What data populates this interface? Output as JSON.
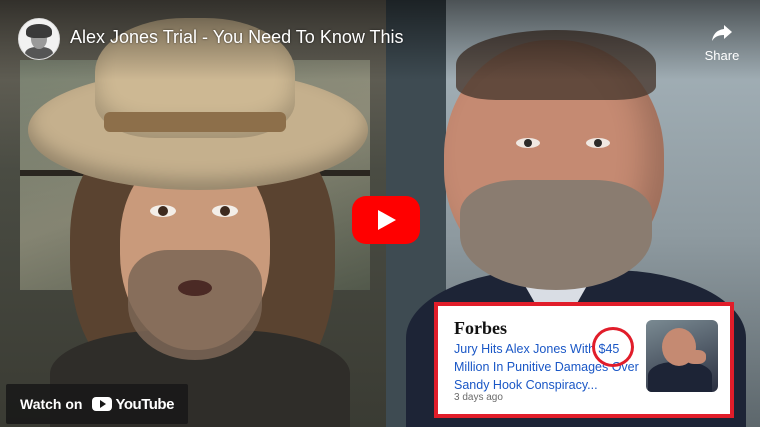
{
  "video": {
    "title": "Alex Jones Trial - You Need To Know This",
    "share_label": "Share",
    "watch_on_label": "Watch on",
    "platform_name": "YouTube"
  },
  "forbes_card": {
    "brand": "Forbes",
    "headline_before": "Jury Hits Alex Jones With ",
    "headline_amount": "$45",
    "headline_after": " Million In Punitive Damages Over Sandy Hook Conspiracy...",
    "time_ago": "3 days ago"
  },
  "icons": {
    "share": "share-arrow-icon",
    "play": "play-icon",
    "youtube": "youtube-logo-icon"
  },
  "colors": {
    "youtube_red": "#ff0000",
    "highlight_red": "#e11d2a",
    "headline_blue": "#1a57c6"
  }
}
